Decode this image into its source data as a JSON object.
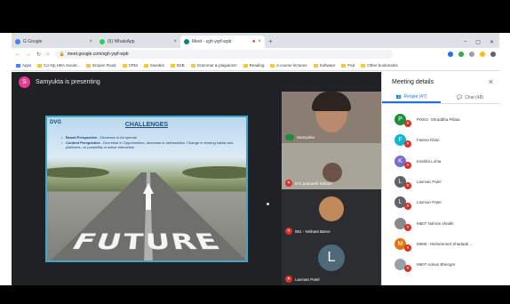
{
  "browser": {
    "tabs": [
      {
        "label": "G Google",
        "color": "#4285f4",
        "active": false
      },
      {
        "label": "(6) WhatsApp",
        "color": "#25d366",
        "active": false
      },
      {
        "label": "Meet - sgh-yqrf-wpb",
        "color": "#00897b",
        "active": true
      }
    ],
    "new_tab": "+",
    "window_controls": [
      "–",
      "▢",
      "✕"
    ],
    "url": "meet.google.com/sgh-yqrf-wpb",
    "bookmarks": [
      "Apps",
      "Co-Op HBA Societ...",
      "Empire Road",
      "CRM",
      "Sweden",
      "B2B",
      "Grammar & plagiarism",
      "Reading",
      "e course lectures",
      "Software",
      "Fed",
      "Other bookmarks"
    ]
  },
  "meeting": {
    "presenter_initial": "S",
    "presenter_text": "Samyukta is presenting",
    "tiles": [
      {
        "name": "Samyukta",
        "initial": ""
      },
      {
        "name": "671 prasanth Sahani",
        "initial": ""
      },
      {
        "name": "881 - Nishant Barve",
        "initial": ""
      },
      {
        "name": "Laxman Patel",
        "initial": "L"
      }
    ]
  },
  "slide": {
    "logo": "DVG",
    "title": "CHALLENGES",
    "bullets": [
      {
        "lead": "Brand Perspective",
        "text": "- Decrease in Ad spends"
      },
      {
        "lead": "Content Perspective",
        "text": "- Decrease in Opportunities, decrease in deliverables. Change in viewing habits and platforms, no possibility of active interaction"
      }
    ],
    "word": "FUTURE"
  },
  "panel": {
    "title": "Meeting details",
    "close": "×",
    "tabs": [
      {
        "label": "People (47)",
        "active": true
      },
      {
        "label": "Chat (48)",
        "active": false
      }
    ],
    "people": [
      {
        "initial": "P",
        "name": "P0041- Shraddha Pillaia",
        "color": "#1e8e3e"
      },
      {
        "initial": "F",
        "name": "Fatima Khan",
        "color": "#12b5cb"
      },
      {
        "initial": "K",
        "name": "Kashifa Lohia",
        "color": "#7b68c8"
      },
      {
        "initial": "L",
        "name": "Laxman Patel",
        "color": "#5f6368"
      },
      {
        "initial": "L",
        "name": "Laxman Patel",
        "color": "#5f6368"
      },
      {
        "initial": "",
        "name": "M607 Nahran shaikh",
        "color": "#8a8a8a"
      },
      {
        "initial": "M",
        "name": "M696 - Mohammed Shadaab ...",
        "color": "#e8710a"
      },
      {
        "initial": "",
        "name": "M607 Adnan Bhengre",
        "color": "#9aa0a6"
      }
    ]
  }
}
